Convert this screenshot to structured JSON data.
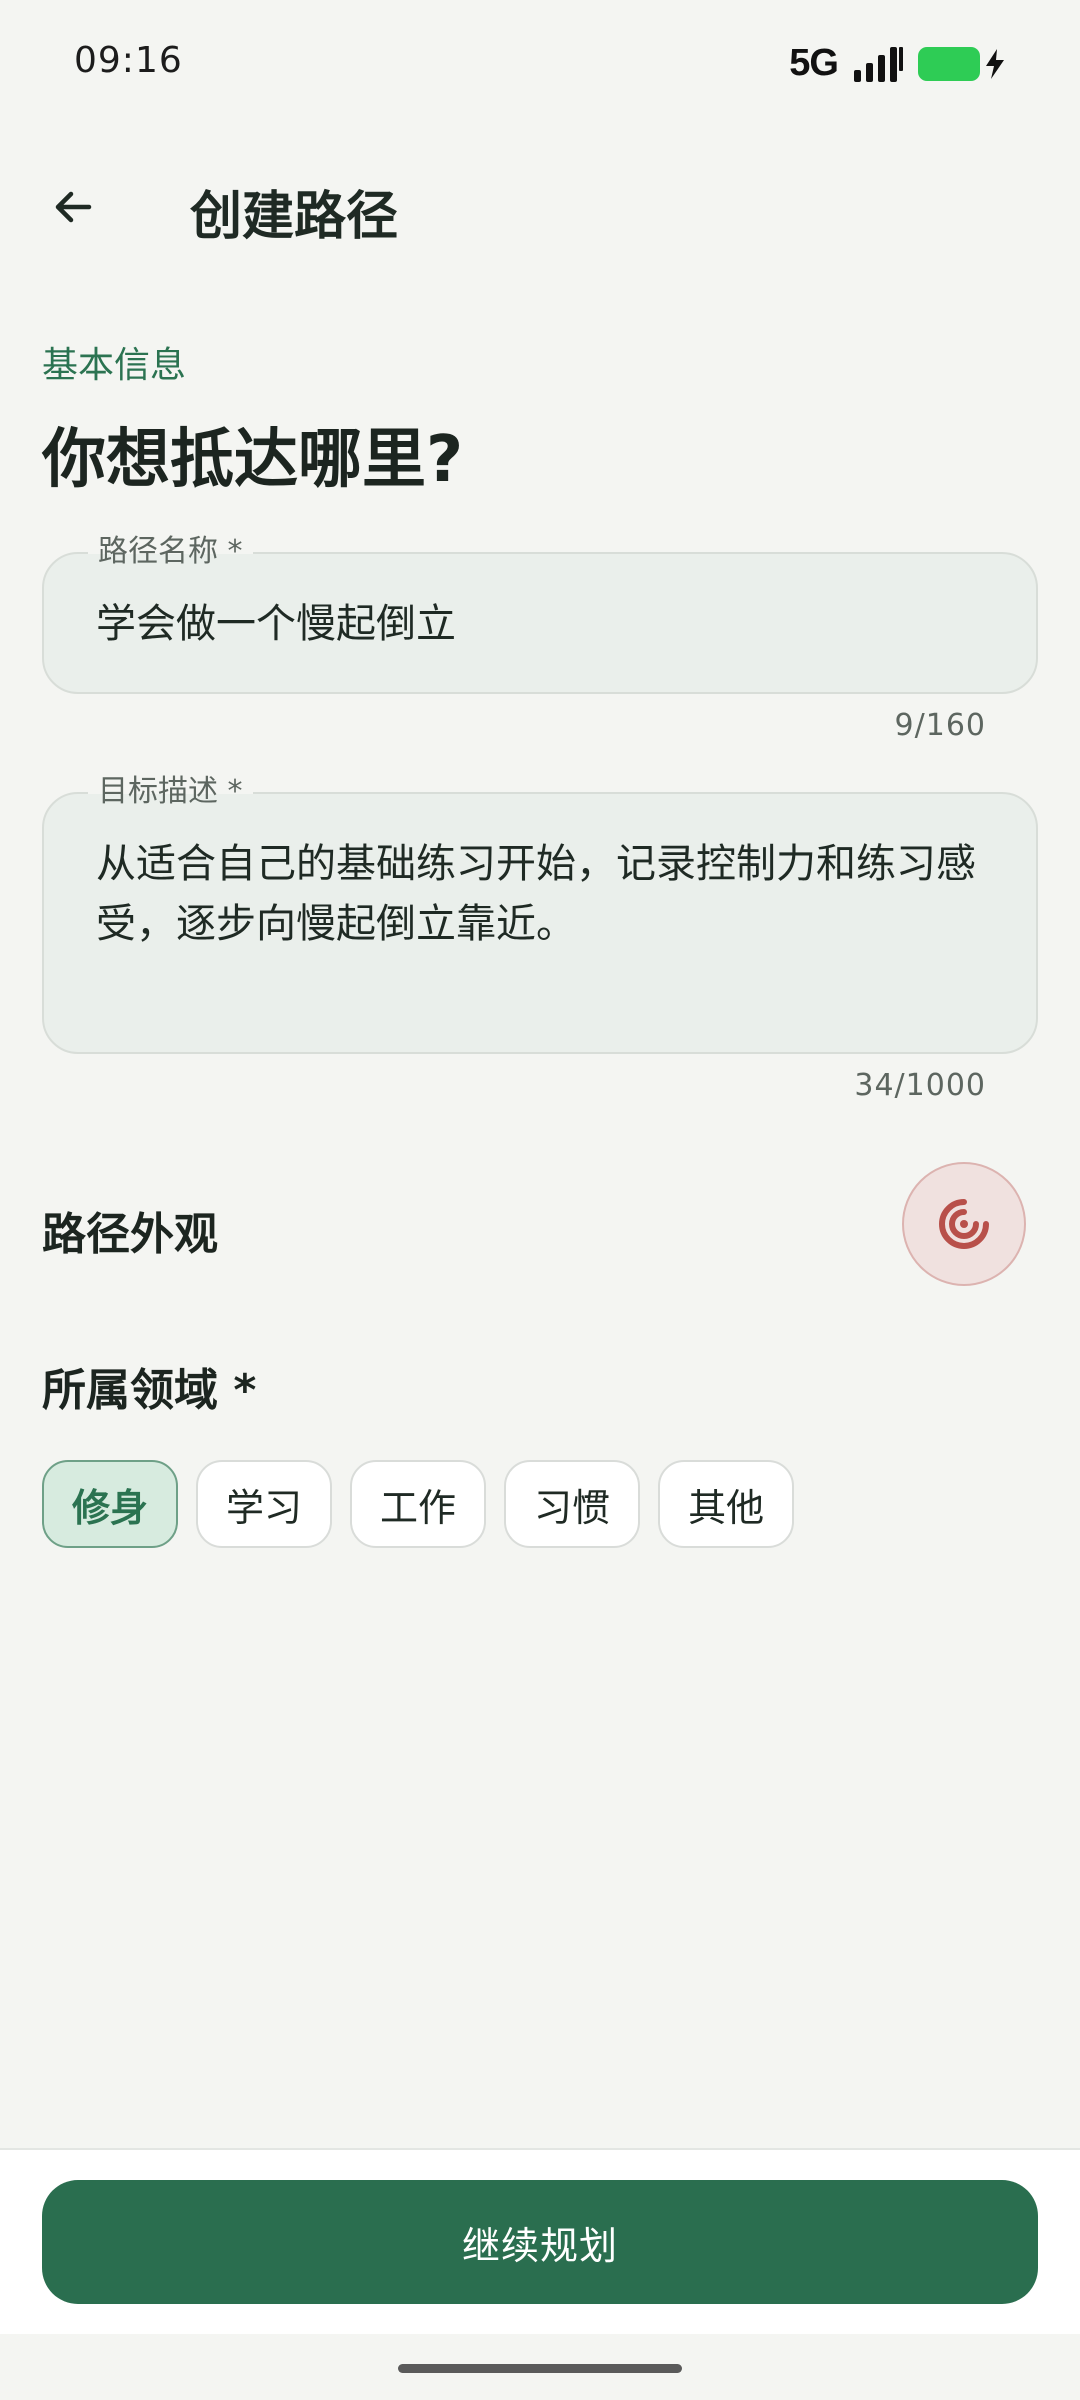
{
  "status_bar": {
    "time": "09:16",
    "network": "5G",
    "icons": [
      "signal-icon",
      "battery-icon",
      "charging-bolt-icon"
    ],
    "battery_color": "#2ecc55"
  },
  "app_bar": {
    "back_icon": "arrow-left-icon",
    "title": "创建路径"
  },
  "section": {
    "label": "基本信息",
    "headline": "你想抵达哪里?"
  },
  "fields": {
    "name": {
      "label": "路径名称 *",
      "value": "学会做一个慢起倒立",
      "counter": "9/160"
    },
    "description": {
      "label": "目标描述 *",
      "value": "从适合自己的基础练习开始，记录控制力和练习感受，逐步向慢起倒立靠近。",
      "counter": "34/1000"
    }
  },
  "appearance": {
    "title": "路径外观",
    "icon": "target-icon",
    "icon_color": "#b8504a"
  },
  "domain": {
    "title": "所属领域 *",
    "selected": "修身",
    "options": [
      "修身",
      "学习",
      "工作",
      "习惯",
      "其他"
    ]
  },
  "footer": {
    "continue_label": "继续规划",
    "accent": "#2a6e4f"
  }
}
